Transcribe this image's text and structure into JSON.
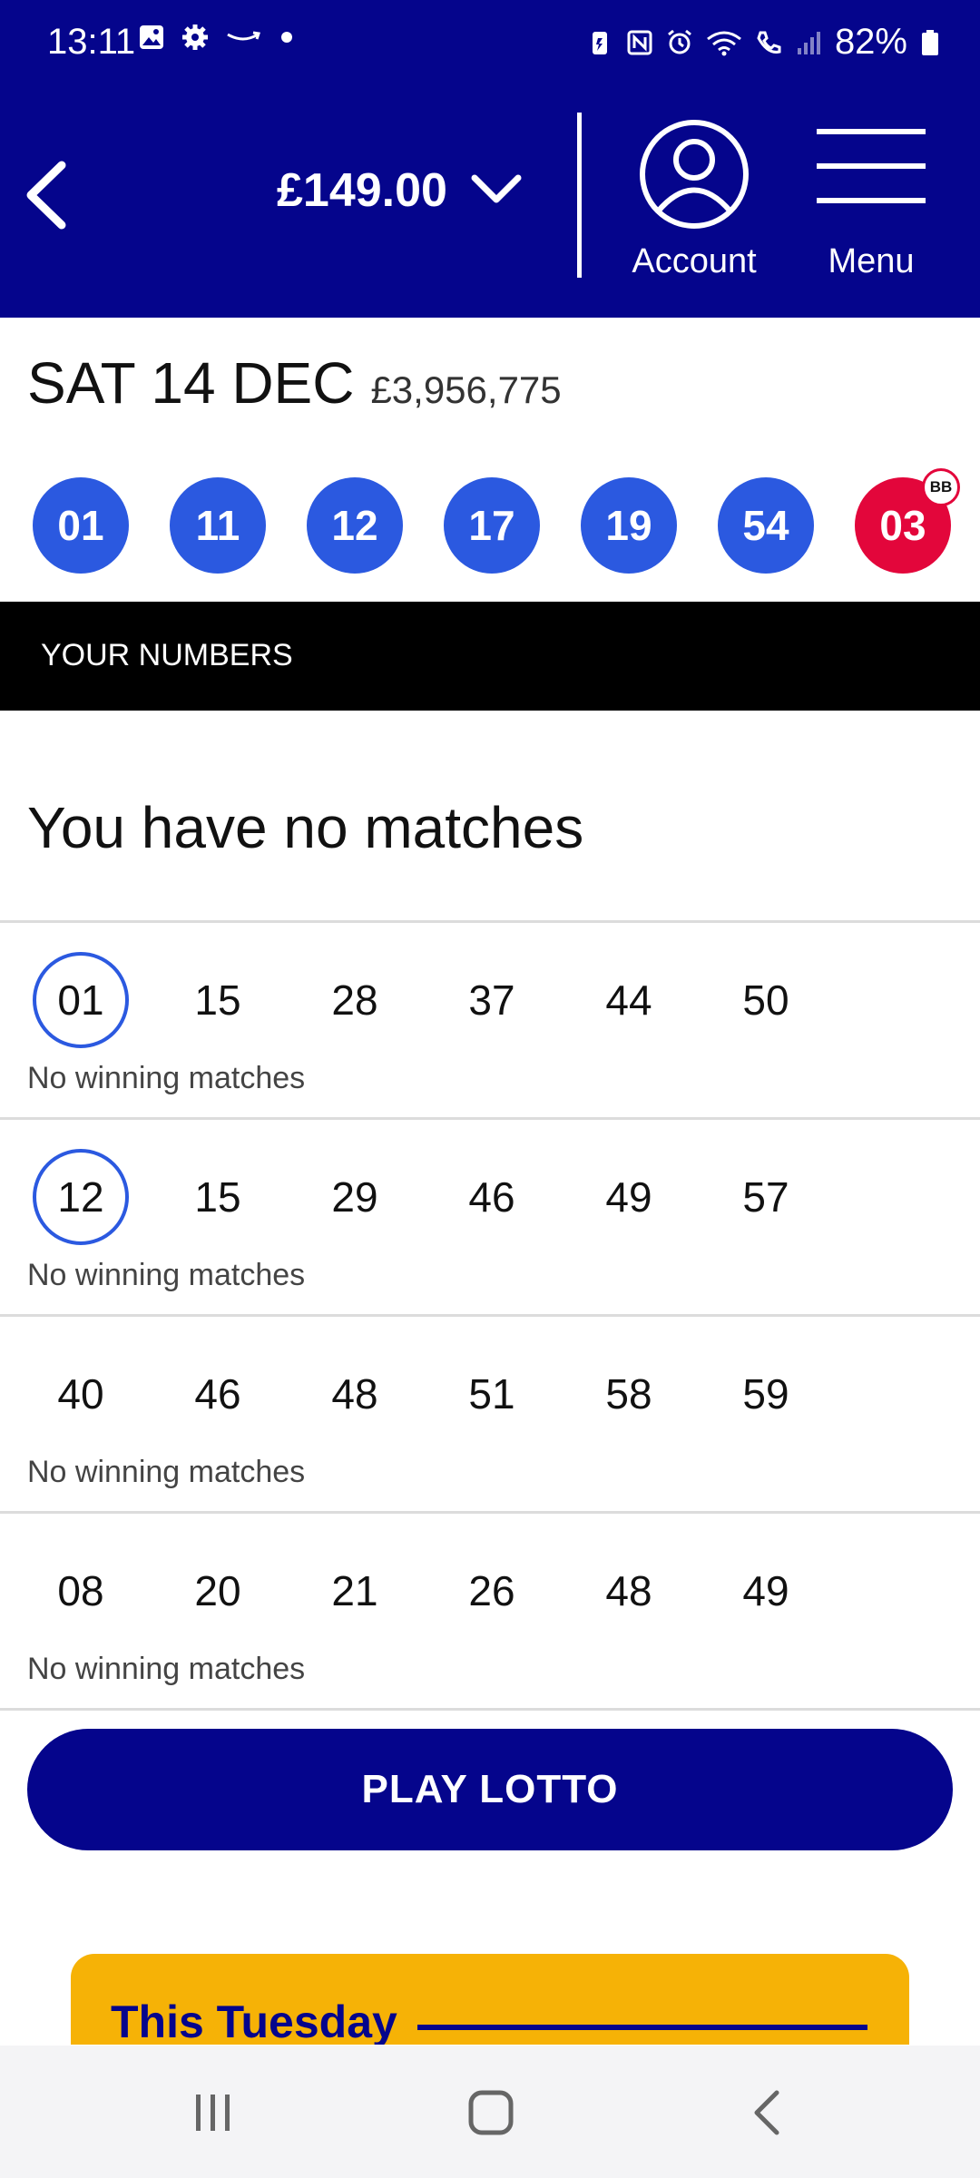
{
  "status_bar": {
    "time": "13:11",
    "battery_percent": "82%",
    "left_icons": [
      "gallery-icon",
      "settings-icon",
      "amazon-icon",
      "dot-icon"
    ],
    "right_icons": [
      "battery-saver-icon",
      "nfc-icon",
      "alarm-icon",
      "wifi-icon",
      "wifi-call-icon",
      "signal-icon",
      "battery-icon"
    ]
  },
  "header": {
    "balance": "£149.00",
    "account_label": "Account",
    "menu_label": "Menu"
  },
  "draw": {
    "date": "SAT 14 DEC",
    "prize": "£3,956,775",
    "balls": [
      "01",
      "11",
      "12",
      "17",
      "19",
      "54"
    ],
    "bonus_ball": "03",
    "bonus_badge": "BB"
  },
  "your_numbers_title": "YOUR NUMBERS",
  "result_message": "You have no matches",
  "lines": [
    {
      "numbers": [
        "01",
        "15",
        "28",
        "37",
        "44",
        "50"
      ],
      "matched": [
        true,
        false,
        false,
        false,
        false,
        false
      ],
      "status": "No winning matches"
    },
    {
      "numbers": [
        "12",
        "15",
        "29",
        "46",
        "49",
        "57"
      ],
      "matched": [
        true,
        false,
        false,
        false,
        false,
        false
      ],
      "status": "No winning matches"
    },
    {
      "numbers": [
        "40",
        "46",
        "48",
        "51",
        "58",
        "59"
      ],
      "matched": [
        false,
        false,
        false,
        false,
        false,
        false
      ],
      "status": "No winning matches"
    },
    {
      "numbers": [
        "08",
        "20",
        "21",
        "26",
        "48",
        "49"
      ],
      "matched": [
        false,
        false,
        false,
        false,
        false,
        false
      ],
      "status": "No winning matches"
    }
  ],
  "play_button": "PLAY LOTTO",
  "promo": {
    "title": "This Tuesday"
  },
  "colors": {
    "brand_navy": "#05058c",
    "ball_blue": "#2b59e0",
    "bonus_red": "#e3063b",
    "promo_yellow": "#f6b206"
  }
}
